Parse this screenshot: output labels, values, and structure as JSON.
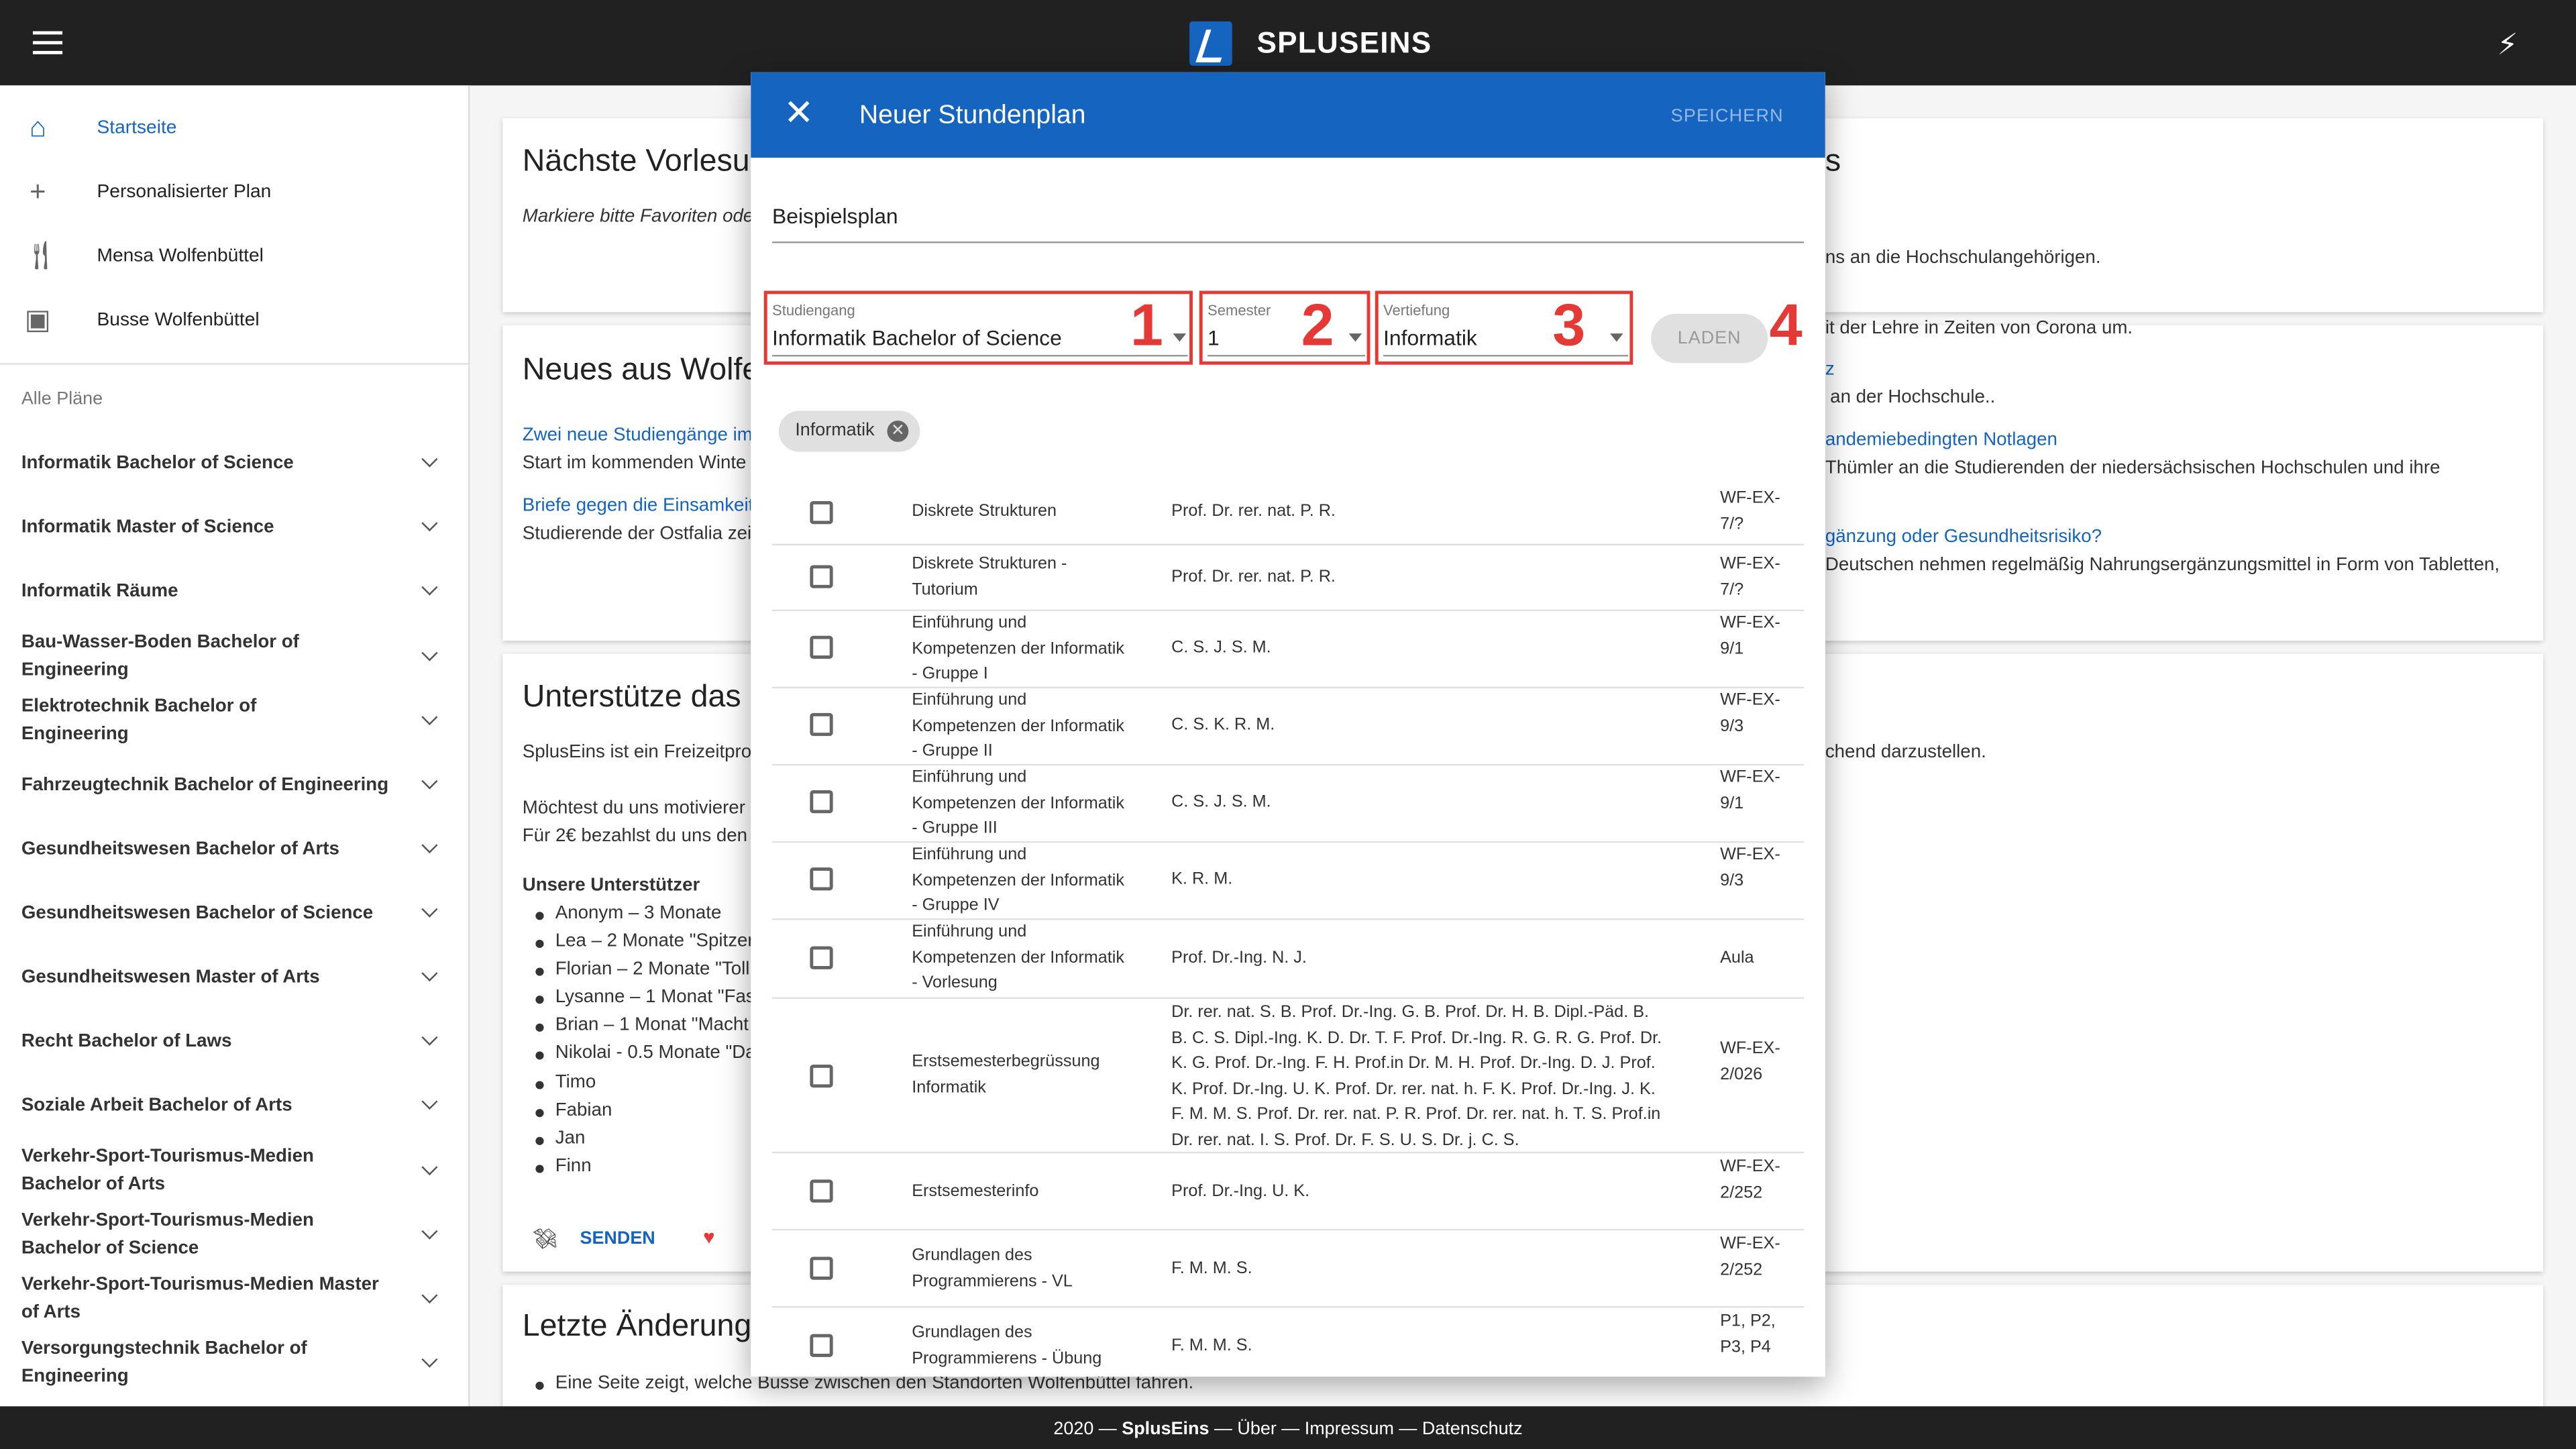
{
  "header": {
    "brand": "SPLUSEINS"
  },
  "sidebar": {
    "nav": [
      {
        "icon": "home-icon",
        "label": "Startseite",
        "active": true
      },
      {
        "icon": "plus-icon",
        "label": "Personalisierter Plan"
      },
      {
        "icon": "utensils-icon",
        "label": "Mensa Wolfenbüttel"
      },
      {
        "icon": "bus-icon",
        "label": "Busse Wolfenbüttel"
      }
    ],
    "all_plans_label": "Alle Pläne",
    "plans": [
      "Informatik Bachelor of Science",
      "Informatik Master of Science",
      "Informatik Räume",
      "Bau-Wasser-Boden Bachelor of Engineering",
      "Elektrotechnik Bachelor of Engineering",
      "Fahrzeugtechnik Bachelor of Engineering",
      "Gesundheitswesen Bachelor of Arts",
      "Gesundheitswesen Bachelor of Science",
      "Gesundheitswesen Master of Arts",
      "Recht Bachelor of Laws",
      "Soziale Arbeit Bachelor of Arts",
      "Verkehr-Sport-Tourismus-Medien Bachelor of Arts",
      "Verkehr-Sport-Tourismus-Medien Bachelor of Science",
      "Verkehr-Sport-Tourismus-Medien Master of Arts",
      "Versorgungstechnik Bachelor of Engineering"
    ]
  },
  "cards": {
    "next": {
      "title": "Nächste Vorlesu",
      "text": "Markiere bitte Favoriten ode"
    },
    "news": {
      "title": "Neues aus Wolfe",
      "item1_link": "Zwei neue Studiengänge im",
      "item1_text": "Start im kommenden Winte",
      "item2_link": "Briefe gegen die Einsamkeit",
      "item2_text": "Studierende der Ostfalia zei"
    },
    "support": {
      "title": "Unterstütze das",
      "text1": "SplusEins ist ein Freizeitpro",
      "text2": "Möchtest du uns motivierer",
      "text3": "Für 2€ bezahlst du uns den",
      "supporters_title": "Unsere Unterstützer",
      "supporters": [
        "Anonym – 3 Monate",
        "Lea – 2 Monate \"Spitzer",
        "Florian – 2 Monate \"Toll",
        "Lysanne – 1 Monat \"Fas",
        "Brian – 1 Monat \"Macht",
        "Nikolai - 0.5 Monate \"Da",
        "Timo",
        "Fabian",
        "Jan",
        "Finn"
      ],
      "send_label": "SENDEN"
    },
    "changes": {
      "title": "Letzte Änderung",
      "item1": "Eine Seite zeigt, welche Busse zwischen den Standorten Wolfenbüttel fahren."
    },
    "right": {
      "title": "s",
      "l1": "ns an die Hochschulangehörigen.",
      "l2": "it der Lehre in Zeiten von Corona um.",
      "l3_link": "z",
      "l4": "an der Hochschule..",
      "l5_link": "andemiebedingten Notlagen",
      "l6": "Thümler an die Studierenden der niedersächsischen Hochschulen und ihre",
      "l7_link": "gänzung oder Gesundheitsrisiko?",
      "l8": "Deutschen nehmen regelmäßig Nahrungsergänzungsmittel in Form von Tabletten,",
      "l9": "chend darzustellen."
    }
  },
  "dialog": {
    "title": "Neuer Stundenplan",
    "save_label": "SPEICHERN",
    "name_value": "Beispielsplan",
    "studiengang": {
      "label": "Studiengang",
      "value": "Informatik Bachelor of Science",
      "marker": "1"
    },
    "semester": {
      "label": "Semester",
      "value": "1",
      "marker": "2"
    },
    "vertiefung": {
      "label": "Vertiefung",
      "value": "Informatik",
      "marker": "3"
    },
    "load_label": "LADEN",
    "load_marker": "4",
    "chip": "Informatik",
    "courses": [
      {
        "name": "Diskrete Strukturen",
        "prof": "Prof. Dr. rer. nat. P. R.",
        "room": "WF-EX-7/?"
      },
      {
        "name": "Diskrete Strukturen - Tutorium",
        "prof": "Prof. Dr. rer. nat. P. R.",
        "room": "WF-EX-7/?"
      },
      {
        "name": "Einführung und Kompetenzen der Informatik - Gruppe I",
        "prof": "C. S. J. S. M.",
        "room": "WF-EX-9/1"
      },
      {
        "name": "Einführung und Kompetenzen der Informatik - Gruppe II",
        "prof": "C. S. K. R. M.",
        "room": "WF-EX-9/3"
      },
      {
        "name": "Einführung und Kompetenzen der Informatik - Gruppe III",
        "prof": "C. S. J. S. M.",
        "room": "WF-EX-9/1"
      },
      {
        "name": "Einführung und Kompetenzen der Informatik - Gruppe IV",
        "prof": "K. R. M.",
        "room": "WF-EX-9/3"
      },
      {
        "name": "Einführung und Kompetenzen der Informatik - Vorlesung",
        "prof": "Prof. Dr.-Ing. N. J.",
        "room": "Aula"
      },
      {
        "name": "Erstsemesterbegrüssung Informatik",
        "prof": "Dr. rer. nat. S. B. Prof. Dr.-Ing. G. B. Prof. Dr. H. B. Dipl.-Päd. B. B. C. S. Dipl.-Ing. K. D. Dr. T. F. Prof. Dr.-Ing. R. G. R. G. Prof. Dr. K. G. Prof. Dr.-Ing. F. H. Prof.in Dr. M. H. Prof. Dr.-Ing. D. J. Prof. K. Prof. Dr.-Ing. U. K. Prof. Dr. rer. nat. h. F. K. Prof. Dr.-Ing. J. K. F. M. M. S. Prof. Dr. rer. nat. P. R. Prof. Dr. rer. nat. h. T. S. Prof.in Dr. rer. nat. I. S. Prof. Dr. F. S. U. S. Dr. j. C. S.",
        "room": "WF-EX-2/026"
      },
      {
        "name": "Erstsemesterinfo",
        "prof": "Prof. Dr.-Ing. U. K.",
        "room": "WF-EX-2/252"
      },
      {
        "name": "Grundlagen des Programmierens - VL",
        "prof": "F. M. M. S.",
        "room": "WF-EX-2/252"
      },
      {
        "name": "Grundlagen des Programmierens - Übung",
        "prof": "F. M. M. S.",
        "room": "P1, P2, P3, P4"
      }
    ]
  },
  "footer": {
    "year": "2020 —",
    "brand": "SplusEins",
    "rest": "— Über — Impressum — Datenschutz"
  }
}
